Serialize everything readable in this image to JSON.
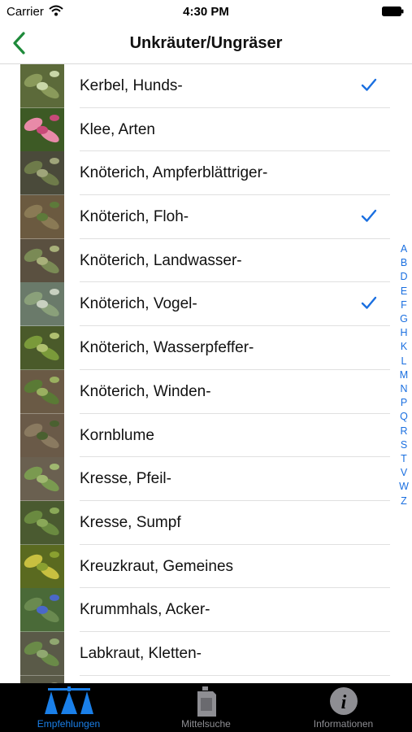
{
  "status_bar": {
    "carrier": "Carrier",
    "time": "4:30 PM"
  },
  "nav": {
    "title": "Unkräuter/Ungräser",
    "back_icon": "chevron-left-icon"
  },
  "list": {
    "items": [
      {
        "label": "Kerbel, Hunds-",
        "checked": true,
        "thumb": [
          "#5c6a3a",
          "#8a9a5b",
          "#c9d7a8"
        ]
      },
      {
        "label": "Klee, Arten",
        "checked": false,
        "thumb": [
          "#3d5a25",
          "#e88aa8",
          "#c84a78"
        ]
      },
      {
        "label": "Knöterich, Ampferblättriger-",
        "checked": false,
        "thumb": [
          "#4a4a3a",
          "#6e7b4a",
          "#9fa57a"
        ]
      },
      {
        "label": "Knöterich, Floh-",
        "checked": true,
        "thumb": [
          "#6b5a40",
          "#8a7a55",
          "#5d7a3a"
        ]
      },
      {
        "label": "Knöterich, Landwasser-",
        "checked": false,
        "thumb": [
          "#5a5040",
          "#7a8a55",
          "#a8b07a"
        ]
      },
      {
        "label": "Knöterich, Vogel-",
        "checked": true,
        "thumb": [
          "#6a7a6a",
          "#8aa07a",
          "#c8d0c0"
        ]
      },
      {
        "label": "Knöterich, Wasserpfeffer-",
        "checked": false,
        "thumb": [
          "#4a5a2a",
          "#7a9a3a",
          "#b0c070"
        ]
      },
      {
        "label": "Knöterich, Winden-",
        "checked": false,
        "thumb": [
          "#6a5a45",
          "#5a7a35",
          "#9ab060"
        ]
      },
      {
        "label": "Kornblume",
        "checked": false,
        "thumb": [
          "#6a5a48",
          "#8a7a60",
          "#4a6030"
        ]
      },
      {
        "label": "Kresse, Pfeil-",
        "checked": false,
        "thumb": [
          "#6a6050",
          "#7a9a50",
          "#a0b870"
        ]
      },
      {
        "label": "Kresse, Sumpf",
        "checked": false,
        "thumb": [
          "#4a5a30",
          "#6a8a40",
          "#8aa858"
        ]
      },
      {
        "label": "Kreuzkraut, Gemeines",
        "checked": false,
        "thumb": [
          "#5a6a20",
          "#c8c040",
          "#8aa030"
        ]
      },
      {
        "label": "Krummhals, Acker-",
        "checked": false,
        "thumb": [
          "#4a6a38",
          "#6a8a50",
          "#4a68c8"
        ]
      },
      {
        "label": "Labkraut, Kletten-",
        "checked": false,
        "thumb": [
          "#5a5a48",
          "#6a8a48",
          "#90a870"
        ]
      },
      {
        "label": "",
        "checked": false,
        "thumb": [
          "#5a5a48",
          "#708a50",
          "#909070"
        ]
      }
    ]
  },
  "alpha_index": [
    "A",
    "B",
    "D",
    "E",
    "F",
    "G",
    "H",
    "K",
    "L",
    "M",
    "N",
    "P",
    "Q",
    "R",
    "S",
    "T",
    "V",
    "W",
    "Z"
  ],
  "tabs": [
    {
      "label": "Empfehlungen",
      "icon": "sprayer-icon",
      "active": true
    },
    {
      "label": "Mittelsuche",
      "icon": "canister-icon",
      "active": false
    },
    {
      "label": "Informationen",
      "icon": "info-icon",
      "active": false
    }
  ],
  "colors": {
    "accent_blue": "#1a6fe0",
    "back_green": "#1e8a3a",
    "tab_active": "#1a7fe8",
    "tab_inactive": "#8e8e93"
  }
}
